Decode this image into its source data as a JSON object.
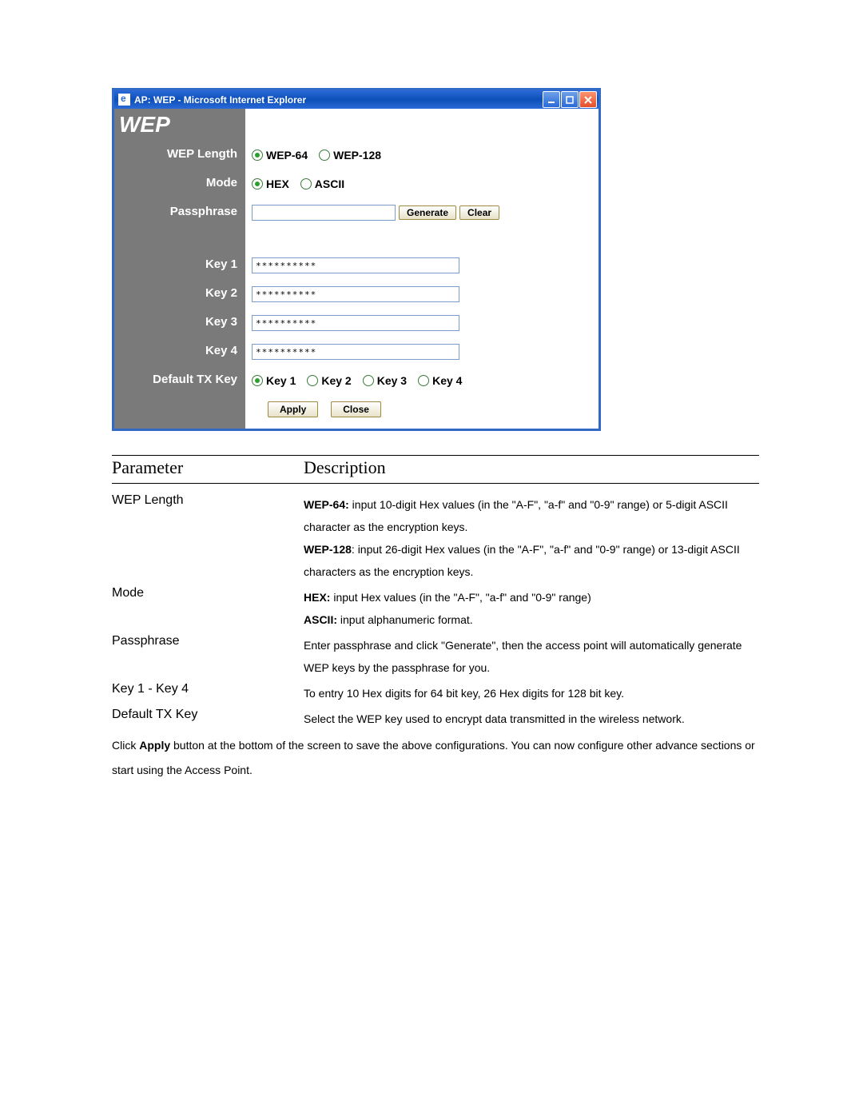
{
  "window": {
    "title": "AP: WEP - Microsoft Internet Explorer"
  },
  "form": {
    "heading": "WEP",
    "labels": {
      "wep_length": "WEP Length",
      "mode": "Mode",
      "passphrase": "Passphrase",
      "key1": "Key 1",
      "key2": "Key 2",
      "key3": "Key 3",
      "key4": "Key 4",
      "default_tx": "Default TX Key"
    },
    "wep_length": {
      "opt1": "WEP-64",
      "opt2": "WEP-128",
      "selected": "WEP-64"
    },
    "mode": {
      "opt1": "HEX",
      "opt2": "ASCII",
      "selected": "HEX"
    },
    "passphrase_value": "",
    "buttons": {
      "generate": "Generate",
      "clear": "Clear",
      "apply": "Apply",
      "close": "Close"
    },
    "keys": {
      "k1": "**********",
      "k2": "**********",
      "k3": "**********",
      "k4": "**********"
    },
    "tx": {
      "opt1": "Key 1",
      "opt2": "Key 2",
      "opt3": "Key 3",
      "opt4": "Key 4",
      "selected": "Key 1"
    }
  },
  "table": {
    "header_param": "Parameter",
    "header_desc": "Description",
    "rows": {
      "wep_length": {
        "param": "WEP Length",
        "b1": "WEP-64:",
        "t1": " input 10-digit Hex values (in the \"A-F\", \"a-f\" and \"0-9\" range) or 5-digit ASCII character as the encryption keys.",
        "b2": "WEP-128",
        "t2": ": input 26-digit Hex values (in the \"A-F\", \"a-f\" and \"0-9\" range) or 13-digit ASCII characters as the encryption keys."
      },
      "mode": {
        "param": "Mode",
        "b1": "HEX:",
        "t1": " input Hex values (in the \"A-F\", \"a-f\" and \"0-9\" range)",
        "b2": "ASCII:",
        "t2": " input alphanumeric format."
      },
      "passphrase": {
        "param": "Passphrase",
        "t1": "Enter passphrase and click \"Generate\", then the access point will automatically generate WEP keys by the passphrase for you."
      },
      "keys": {
        "param": "Key 1 - Key 4",
        "t1": "To entry 10 Hex digits for 64 bit key, 26 Hex digits for 128 bit key."
      },
      "tx": {
        "param": "Default TX Key",
        "t1": "Select the WEP key used to encrypt data transmitted in the wireless network."
      }
    },
    "footer_pre": "Click ",
    "footer_bold": "Apply",
    "footer_post": " button at the bottom of the screen to save the above configurations. You can now configure other advance sections or start using the Access Point."
  }
}
